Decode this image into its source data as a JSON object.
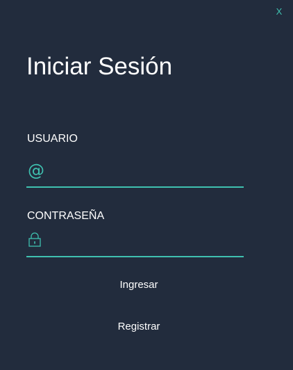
{
  "window": {
    "close_label": "X"
  },
  "login": {
    "title": "Iniciar Sesión",
    "username_label": "USUARIO",
    "username_value": "",
    "password_label": "CONTRASEÑA",
    "password_value": "",
    "login_button": "Ingresar",
    "register_button": "Registrar"
  },
  "icons": {
    "username": "at-icon",
    "password": "lock-icon"
  },
  "colors": {
    "background": "#222c3d",
    "accent": "#3fc1b0",
    "text": "#ffffff"
  }
}
